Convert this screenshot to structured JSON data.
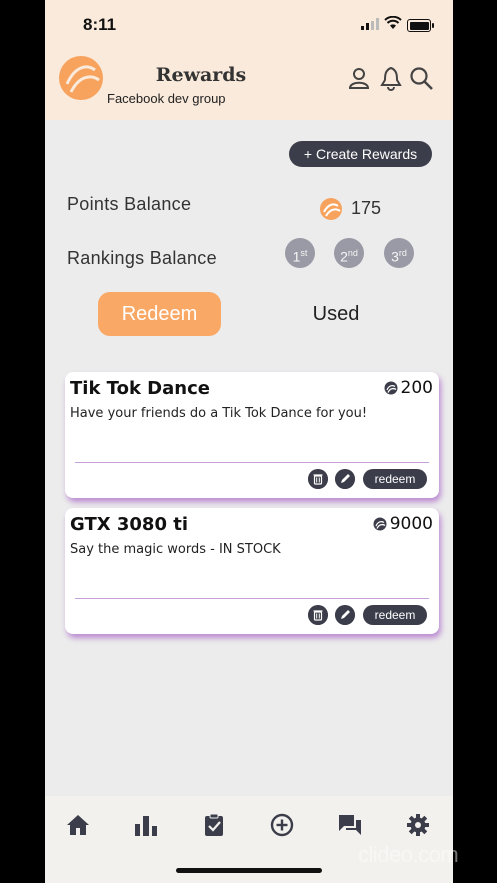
{
  "status_bar": {
    "time": "8:11"
  },
  "header": {
    "title": "Rewards",
    "subtitle": "Facebook dev group"
  },
  "actions": {
    "create_label": "+ Create Rewards"
  },
  "balances": {
    "points_label": "Points Balance",
    "points_value": "175",
    "rankings_label": "Rankings Balance",
    "ranks": [
      {
        "num": "1",
        "suffix": "st"
      },
      {
        "num": "2",
        "suffix": "nd"
      },
      {
        "num": "3",
        "suffix": "rd"
      }
    ]
  },
  "tabs": {
    "redeem": "Redeem",
    "used": "Used"
  },
  "rewards": [
    {
      "title": "Tik Tok Dance",
      "cost": "200",
      "description": "Have your friends do a Tik Tok Dance for you!",
      "redeem_label": "redeem"
    },
    {
      "title": "GTX 3080 ti",
      "cost": "9000",
      "description": "Say the magic words - IN STOCK",
      "redeem_label": "redeem"
    }
  ],
  "nav": [
    "home-icon",
    "leaderboard-icon",
    "tasks-icon",
    "add-icon",
    "chat-icon",
    "settings-icon"
  ],
  "colors": {
    "accent": "#f9a866",
    "dark": "#3b3d4a",
    "header_bg": "#faeadb",
    "card_shadow": "#a855c8"
  },
  "watermark": "clideo.com"
}
